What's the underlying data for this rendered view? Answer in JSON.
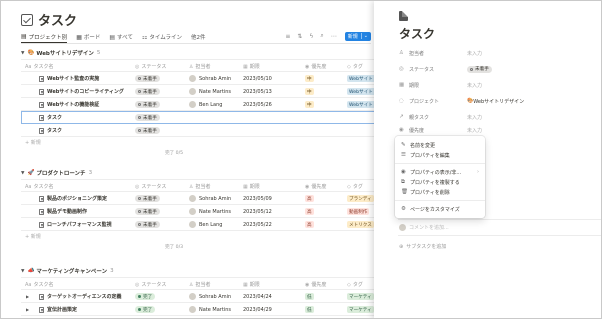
{
  "page": {
    "title": "タスク"
  },
  "tabs": [
    {
      "icon": "▤",
      "label": "プロジェクト別",
      "active": true
    },
    {
      "icon": "▦",
      "label": "ボード"
    },
    {
      "icon": "▤",
      "label": "すべて"
    },
    {
      "icon": "⚏",
      "label": "タイムライン"
    },
    {
      "icon": "",
      "label": "他2件"
    }
  ],
  "toolbar": {
    "new_label": "新規",
    "new_arrow": "⌄"
  },
  "columns": {
    "name": "タスク名",
    "status": "ステータス",
    "owner": "担当者",
    "date": "期限",
    "priority": "優先度",
    "tag": "タグ"
  },
  "groups": [
    {
      "name": "Webサイトリデザイン",
      "count": "5",
      "rows": [
        {
          "name": "Webサイト監査の実施",
          "status": "未着手",
          "owner": "Sohrab Amin",
          "date": "2023/05/10",
          "priority": "中",
          "tag": "Webサイト"
        },
        {
          "name": "Webサイトのコピーライティング",
          "status": "未着手",
          "owner": "Nate Martins",
          "date": "2023/05/13",
          "priority": "中",
          "tag": "Webサイト"
        },
        {
          "name": "Webサイトの機能検証",
          "status": "未着手",
          "owner": "Ben Lang",
          "date": "2023/05/26",
          "priority": "中",
          "tag": "Webサイト"
        },
        {
          "name": "タスク",
          "status": "未着手",
          "owner": "",
          "date": "",
          "priority": "",
          "tag": ""
        },
        {
          "name": "タスク",
          "status": "未着手",
          "owner": "",
          "date": "",
          "priority": "",
          "tag": ""
        }
      ],
      "add_label": "+ 新規",
      "calc": "完了 0/5"
    },
    {
      "name": "プロダクトローンチ",
      "count": "3",
      "rows": [
        {
          "name": "製品のポジショニング策定",
          "status": "未着手",
          "owner": "Sohrab Amin",
          "date": "2023/05/09",
          "priority": "高",
          "tag": "ブランディ"
        },
        {
          "name": "製品デモ動画制作",
          "status": "未着手",
          "owner": "Nate Martins",
          "date": "2023/05/12",
          "priority": "高",
          "tag": "動画制作"
        },
        {
          "name": "ローンチパフォーマンス監視",
          "status": "未着手",
          "owner": "Ben Lang",
          "date": "2023/05/22",
          "priority": "高",
          "tag": "メトリクス"
        }
      ],
      "add_label": "+ 新規",
      "calc": "完了 0/3"
    },
    {
      "name": "マーケティングキャンペーン",
      "count": "3",
      "rows": [
        {
          "name": "ターゲットオーディエンスの定義",
          "status": "完了",
          "owner": "Sohrab Amin",
          "date": "2023/04/24",
          "priority": "低",
          "tag": "マーケティ"
        },
        {
          "name": "宣伝計画策定",
          "status": "完了",
          "owner": "Nate Martins",
          "date": "2023/04/29",
          "priority": "低",
          "tag": "マーケティ"
        }
      ]
    }
  ],
  "panel": {
    "title": "タスク",
    "props": [
      {
        "label": "担当者",
        "value": "未入力"
      },
      {
        "label": "ステータス",
        "value": "未着手"
      },
      {
        "label": "期限",
        "value": "未入力"
      },
      {
        "label": "プロジェクト",
        "value": "Webサイトリデザイン"
      },
      {
        "label": "親タスク",
        "value": "未入力"
      },
      {
        "label": "優先度",
        "value": "未入力"
      }
    ],
    "comment_placeholder": "コメントを追加...",
    "subtask_label": "サブタスクを追加"
  },
  "menu": {
    "items": [
      "名前を変更",
      "プロパティを編集",
      "プロパティの表示/非...",
      "プロパティを複製する",
      "プロパティを削除",
      "ページをカスタマイズ"
    ]
  }
}
